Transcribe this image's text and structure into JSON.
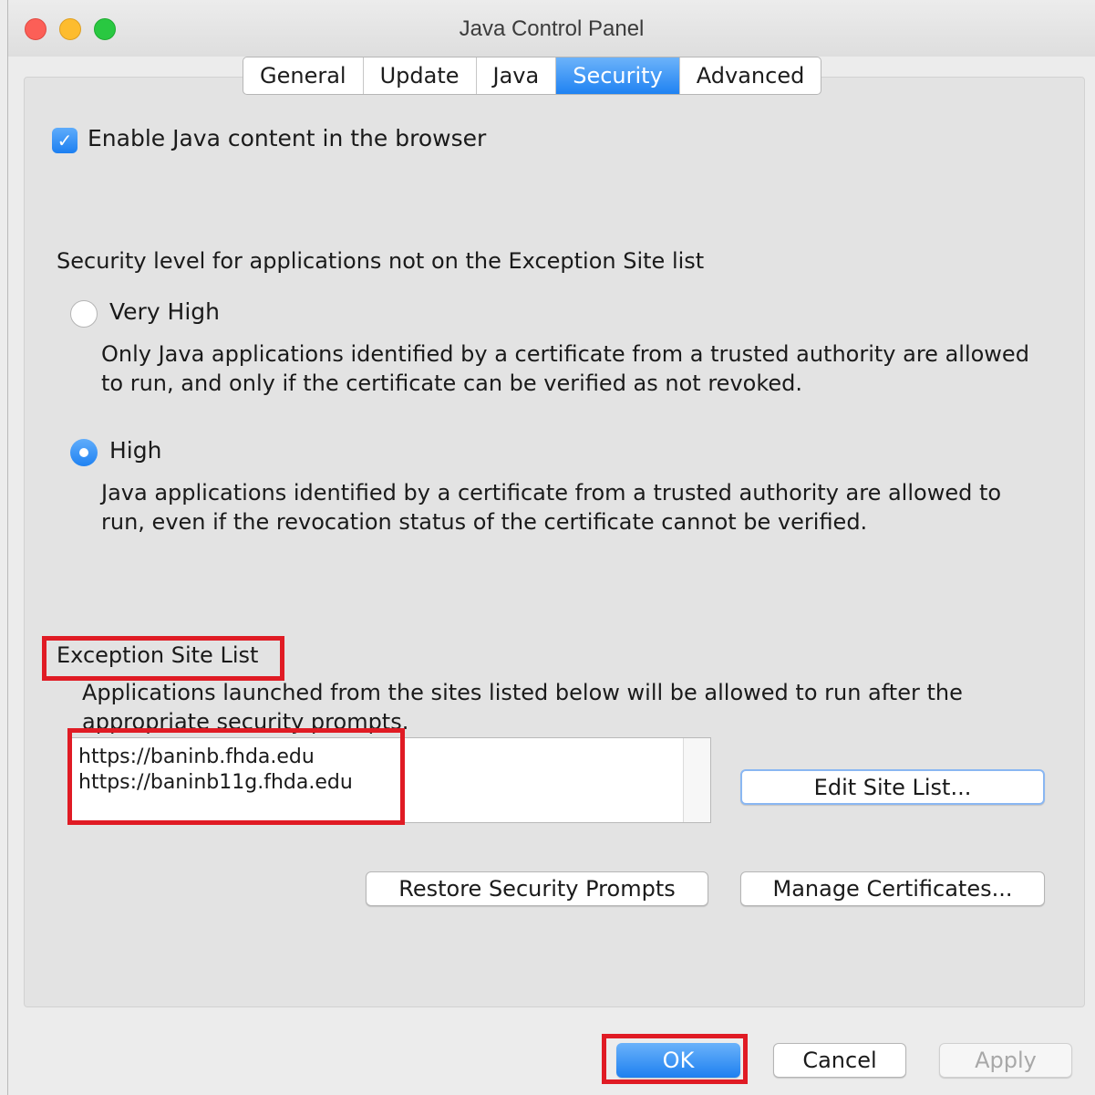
{
  "window": {
    "title": "Java Control Panel"
  },
  "tabs": [
    "General",
    "Update",
    "Java",
    "Security",
    "Advanced"
  ],
  "active_tab": "Security",
  "enable_java": {
    "label": "Enable Java content in the browser",
    "checked": true
  },
  "security_level": {
    "heading": "Security level for applications not on the Exception Site list",
    "options": [
      {
        "label": "Very High",
        "selected": false,
        "description": "Only Java applications identified by a certificate from a trusted authority are allowed to run, and only if the certificate can be verified as not revoked."
      },
      {
        "label": "High",
        "selected": true,
        "description": "Java applications identified by a certificate from a trusted authority are allowed to run, even if the revocation status of the certificate cannot be verified."
      }
    ]
  },
  "exception_site_list": {
    "title": "Exception Site List",
    "description": "Applications launched from the sites listed below will be allowed to run after the appropriate security prompts.",
    "sites": [
      "https://baninb.fhda.edu",
      "https://baninb11g.fhda.edu"
    ],
    "edit_button": "Edit Site List..."
  },
  "buttons": {
    "restore": "Restore Security Prompts",
    "manage": "Manage Certificates...",
    "ok": "OK",
    "cancel": "Cancel",
    "apply": "Apply"
  },
  "colors": {
    "accent": "#1f82f2",
    "highlight": "#e01b24"
  }
}
